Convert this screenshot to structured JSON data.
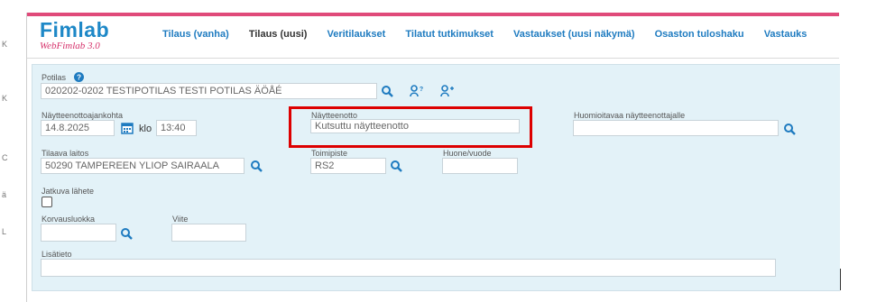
{
  "sidebar": {
    "fragments": [
      "K",
      "K",
      "C",
      "ä",
      "L"
    ]
  },
  "header": {
    "logo_title": "Fimlab",
    "logo_subtitle": "WebFimlab 3.0",
    "nav": [
      {
        "label": "Tilaus (vanha)",
        "active": false
      },
      {
        "label": "Tilaus (uusi)",
        "active": true
      },
      {
        "label": "Veritilaukset",
        "active": false
      },
      {
        "label": "Tilatut tutkimukset",
        "active": false
      },
      {
        "label": "Vastaukset (uusi näkymä)",
        "active": false
      },
      {
        "label": "Osaston tuloshaku",
        "active": false
      },
      {
        "label": "Vastauks",
        "active": false
      }
    ]
  },
  "form": {
    "patient_label": "Potilas",
    "patient_value": "020202-0202 TESTIPOTILAS TESTI POTILAS ÄÖÅÉ",
    "sample_time_label": "Näytteenottoajankohta",
    "sample_date": "14.8.2025",
    "klo_label": "klo",
    "sample_time": "13:40",
    "sampling_label": "Näytteenotto",
    "sampling_value": "Kutsuttu näytteenotto",
    "note_label": "Huomioitavaa näytteenottajalle",
    "note_value": "",
    "orderer_label": "Tilaava laitos",
    "orderer_value": "50290 TAMPEREEN YLIOP SAIRAALA",
    "office_label": "Toimipiste",
    "office_value": "RS2",
    "room_label": "Huone/vuode",
    "room_value": "",
    "continuous_label": "Jatkuva lähete",
    "compensation_label": "Korvausluokka",
    "compensation_value": "",
    "reference_label": "Viite",
    "reference_value": "",
    "extra_label": "Lisätieto",
    "extra_value": ""
  },
  "colors": {
    "accent": "#1e7bc0",
    "brand_pink": "#e04a7a",
    "panel": "#e3f2f8",
    "highlight": "#dd0000"
  }
}
